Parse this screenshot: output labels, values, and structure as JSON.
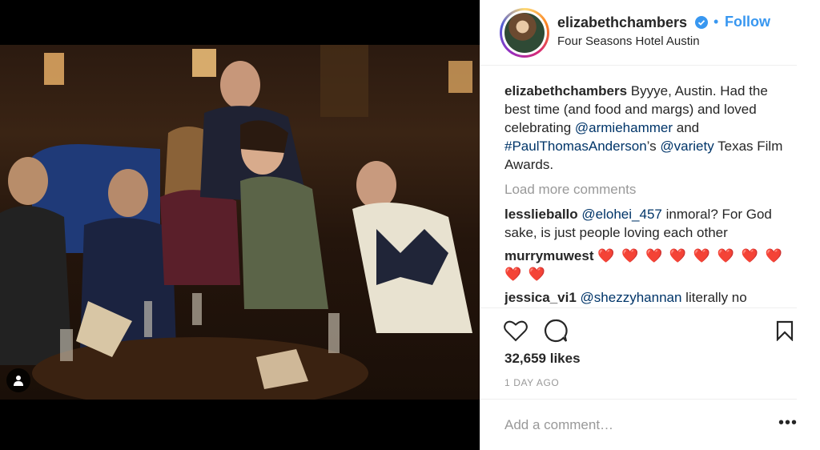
{
  "post": {
    "username": "elizabethchambers",
    "follow_label": "Follow",
    "separator": "•",
    "location": "Four Seasons Hotel Austin",
    "caption": {
      "username": "elizabethchambers",
      "text_1": " Byyye, Austin. Had the best time (and food and margs) and loved celebrating ",
      "mention_1": "@armiehammer",
      "text_2": " and ",
      "hashtag_1": "#PaulThomasAnderson",
      "text_3": "’s ",
      "mention_2": "@variety",
      "text_4": " Texas Film Awards."
    },
    "load_more_label": "Load more comments",
    "comments": [
      {
        "username": "lesslieballo",
        "mention": "@elohei_457",
        "text": " inmoral? For God sake, is just people loving each other"
      },
      {
        "username": "murrymuwest",
        "text": "❤️ ❤️ ❤️ ❤️ ❤️ ❤️ ❤️ ❤️ ❤️ ❤️"
      },
      {
        "username": "jessica_vi1",
        "mention": "@shezzyhannan",
        "text": " literally no"
      }
    ],
    "likes": "32,659 likes",
    "time_ago": "1 DAY AGO",
    "add_comment_placeholder": "Add a comment…",
    "more_options": "•••"
  },
  "icons": {
    "like": "heart-icon",
    "comment": "comment-icon",
    "save": "bookmark-icon",
    "verified": "verified-badge-icon",
    "user_tag": "user-tag-icon"
  },
  "colors": {
    "link": "#003569",
    "follow": "#3897f0",
    "verified": "#3897f0",
    "muted": "#999999",
    "heart": "#ed4956"
  }
}
